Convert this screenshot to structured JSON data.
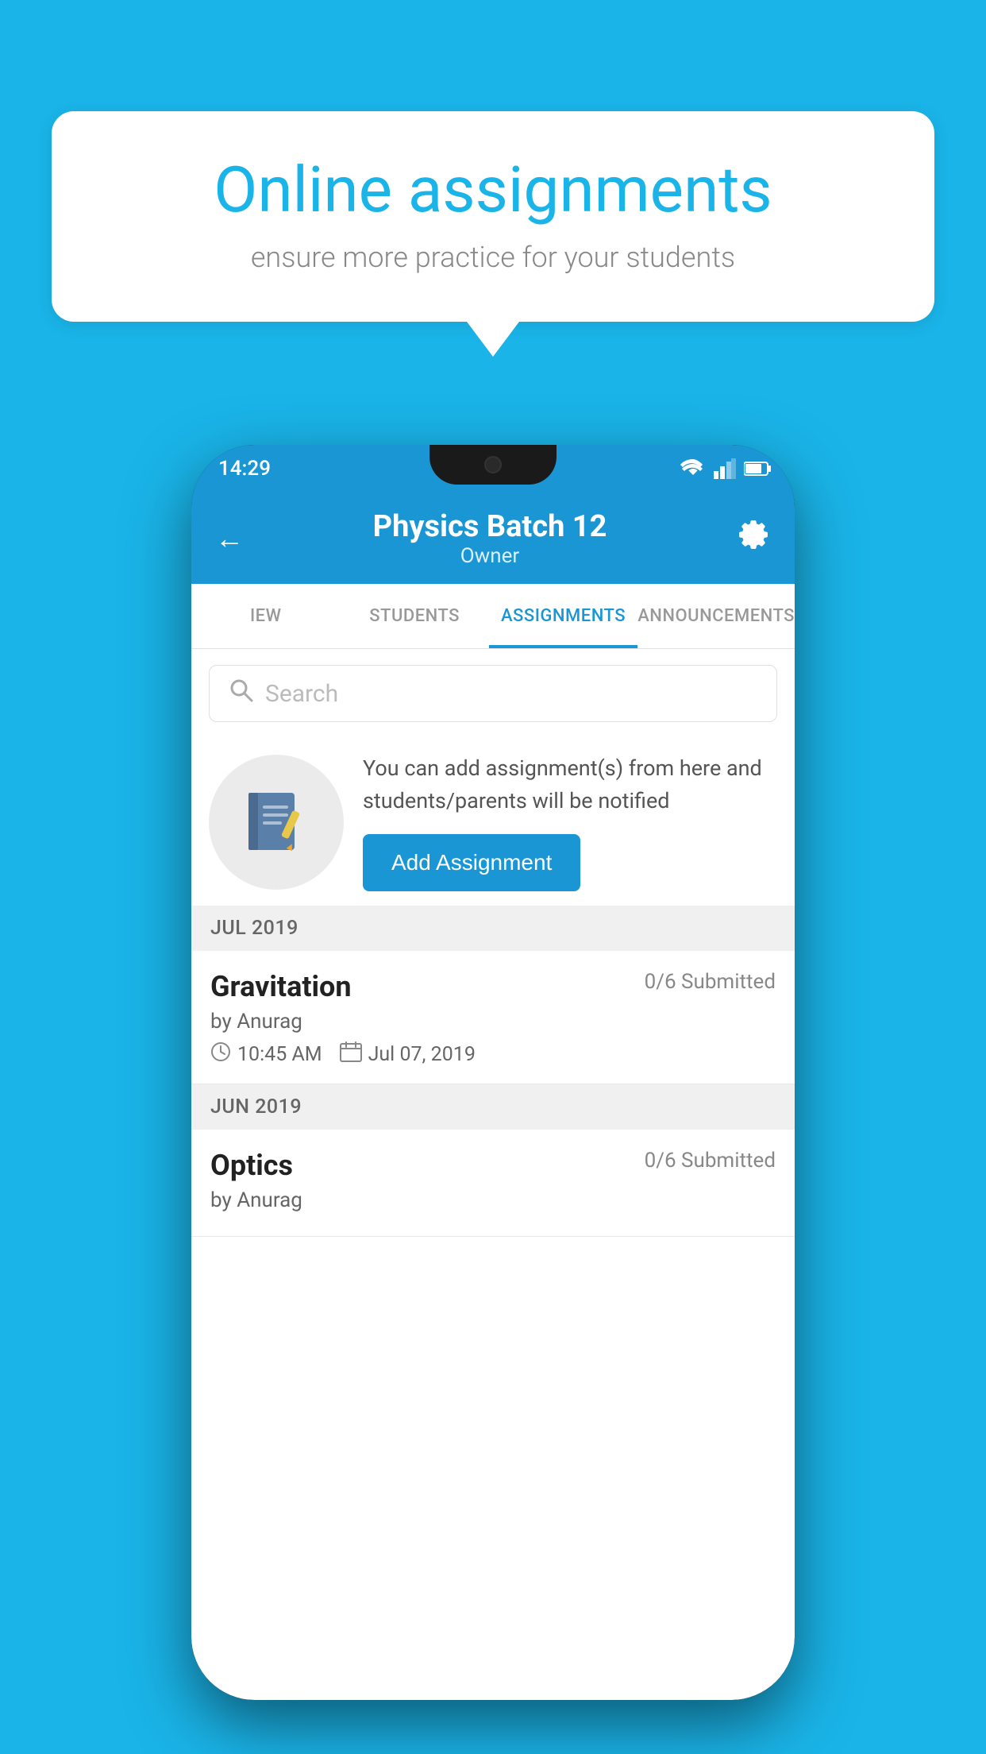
{
  "background_color": "#1ab4e8",
  "speech_bubble": {
    "title": "Online assignments",
    "subtitle": "ensure more practice for your students"
  },
  "phone": {
    "status_bar": {
      "time": "14:29"
    },
    "header": {
      "title": "Physics Batch 12",
      "subtitle": "Owner",
      "back_label": "←",
      "gear_label": "⚙"
    },
    "tabs": [
      {
        "label": "IEW",
        "active": false
      },
      {
        "label": "STUDENTS",
        "active": false
      },
      {
        "label": "ASSIGNMENTS",
        "active": true
      },
      {
        "label": "ANNOUNCEMENTS",
        "active": false
      }
    ],
    "search": {
      "placeholder": "Search"
    },
    "promo": {
      "description": "You can add assignment(s) from here and students/parents will be notified",
      "button_label": "Add Assignment"
    },
    "sections": [
      {
        "label": "JUL 2019",
        "assignments": [
          {
            "name": "Gravitation",
            "submitted": "0/6 Submitted",
            "author": "by Anurag",
            "time": "10:45 AM",
            "date": "Jul 07, 2019"
          }
        ]
      },
      {
        "label": "JUN 2019",
        "assignments": [
          {
            "name": "Optics",
            "submitted": "0/6 Submitted",
            "author": "by Anurag",
            "time": "",
            "date": ""
          }
        ]
      }
    ]
  }
}
